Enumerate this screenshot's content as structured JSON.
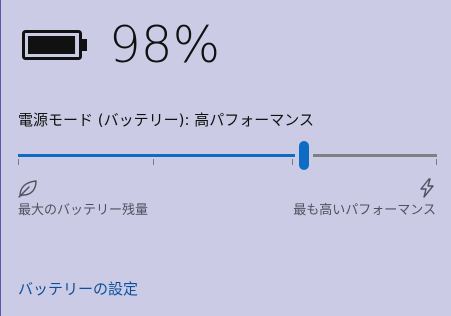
{
  "battery": {
    "percent_text": "98%",
    "level": 0.98,
    "icon": "battery-full-icon"
  },
  "power_mode": {
    "label": "電源モード (バッテリー): 高パフォーマンス",
    "slider_value": 0.66,
    "slider_ticks": [
      0.0,
      0.33,
      0.66,
      1.0
    ],
    "left_end_label": "最大のバッテリー残量",
    "right_end_label": "最も高いパフォーマンス",
    "left_icon": "leaf-icon",
    "right_icon": "lightning-bolt-icon"
  },
  "footer": {
    "link_label": "バッテリーの設定"
  },
  "colors": {
    "background": "#cbcbe5",
    "accent": "#0f6cc5",
    "track_inactive": "#808080",
    "link": "#0a4f9c"
  }
}
